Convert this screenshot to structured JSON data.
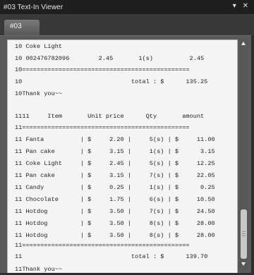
{
  "window": {
    "title": "#03 Text-In Viewer",
    "pin_icon": "▾",
    "close_icon": "✕"
  },
  "tabs": [
    {
      "label": "#03"
    }
  ],
  "viewer": {
    "lines": [
      "10 Coke Light",
      "10 002476782096        2.45       1(s)          2.45",
      "10==============================================",
      "10                              total : $      135.25",
      "10Thank you~~",
      "",
      "1111     Item       Unit price      Qty       amount",
      "11==============================================",
      "11 Fanta          | $     2.20 |     5(s) | $     11.00",
      "11 Pan cake       | $     3.15 |     1(s) | $      3.15",
      "11 Coke Light     | $     2.45 |     5(s) | $     12.25",
      "11 Pan cake       | $     3.15 |     7(s) | $     22.05",
      "11 Candy          | $     0.25 |     1(s) | $      0.25",
      "11 Chocolate      | $     1.75 |     6(s) | $     10.50",
      "11 Hotdog         | $     3.50 |     7(s) | $     24.50",
      "11 Hotdog         | $     3.50 |     8(s) | $     28.00",
      "11 Hotdog         | $     3.50 |     8(s) | $     28.00",
      "11==============================================",
      "11                              total : $      139.70",
      "11Thank you~~"
    ]
  }
}
